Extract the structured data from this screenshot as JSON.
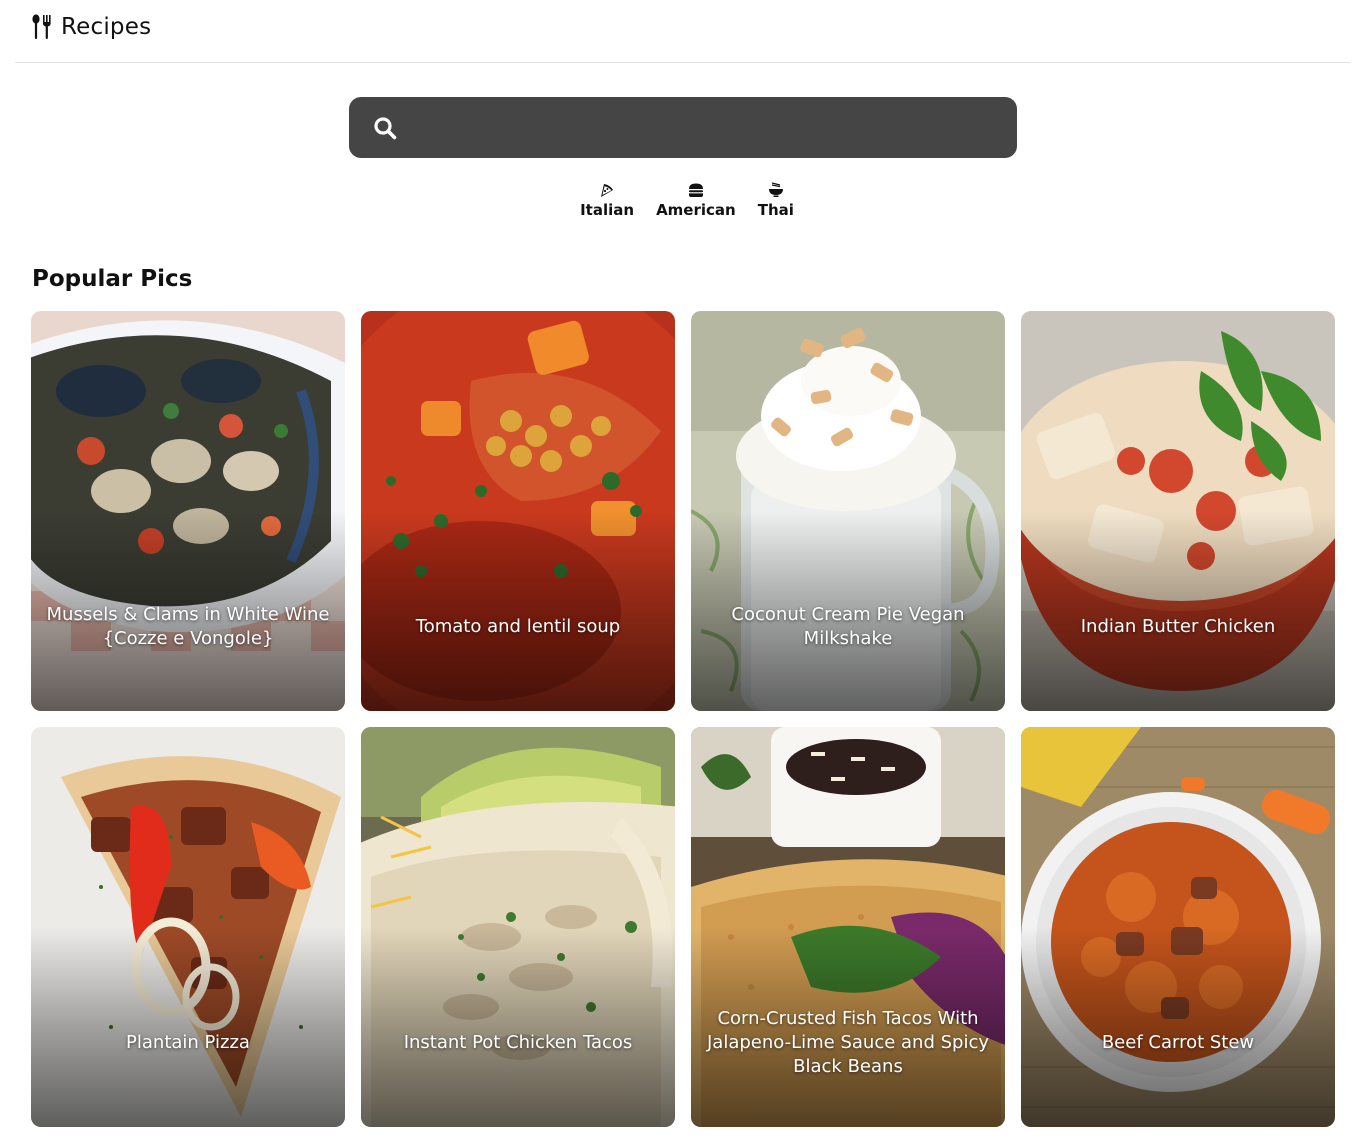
{
  "header": {
    "logo_icon": "utensils-icon",
    "title": "Recipes"
  },
  "search": {
    "icon": "search-icon",
    "value": "",
    "placeholder": ""
  },
  "categories": [
    {
      "label": "Italian",
      "icon": "pizza-icon"
    },
    {
      "label": "American",
      "icon": "hamburger-icon"
    },
    {
      "label": "Thai",
      "icon": "noodle-bowl-icon"
    }
  ],
  "popular": {
    "title": "Popular Pics",
    "items": [
      {
        "title": "Mussels & Clams in White Wine {Cozze e Vongole}"
      },
      {
        "title": "Tomato and lentil soup"
      },
      {
        "title": "Coconut Cream Pie Vegan Milkshake"
      },
      {
        "title": "Indian Butter Chicken"
      },
      {
        "title": "Plantain Pizza"
      },
      {
        "title": "Instant Pot Chicken Tacos"
      },
      {
        "title": "Corn-Crusted Fish Tacos With Jalapeno-Lime Sauce and Spicy Black Beans"
      },
      {
        "title": "Beef Carrot Stew"
      }
    ]
  },
  "colors": {
    "search_bg": "#454545",
    "card_text": "#ffffff",
    "divider": "#e2e2e2"
  }
}
